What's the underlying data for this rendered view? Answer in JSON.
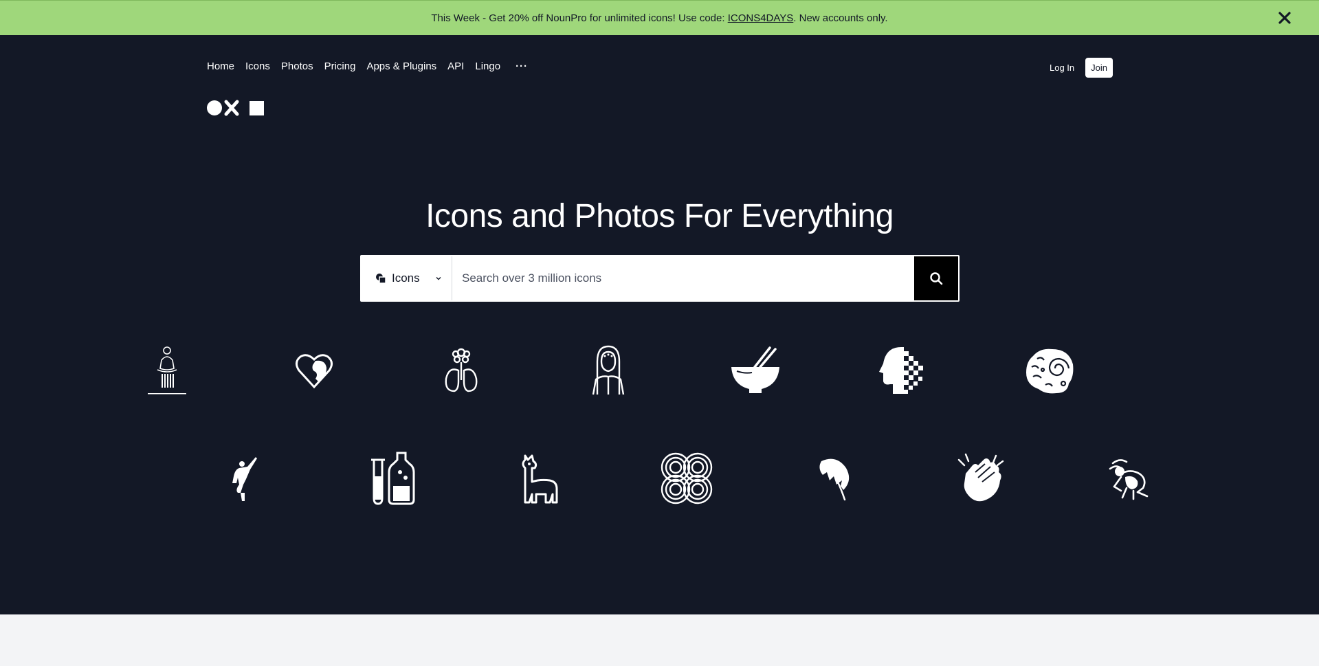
{
  "promo": {
    "text_before": "This Week - Get 20% off NounPro for unlimited icons! Use code: ",
    "code": "ICONS4DAYS",
    "text_after": ". New accounts only."
  },
  "nav": {
    "items": [
      {
        "label": "Home"
      },
      {
        "label": "Icons"
      },
      {
        "label": "Photos"
      },
      {
        "label": "Pricing"
      },
      {
        "label": "Apps & Plugins"
      },
      {
        "label": "API"
      },
      {
        "label": "Lingo"
      }
    ],
    "more": "···"
  },
  "auth": {
    "login": "Log In",
    "join": "Join"
  },
  "hero": {
    "headline": "Icons and Photos For Everything"
  },
  "search": {
    "type_label": "Icons",
    "placeholder": "Search over 3 million icons"
  },
  "colors": {
    "promo_bg": "#9fd77b",
    "hero_bg": "#131826",
    "page_bg": "#f3f4f6"
  },
  "featured_icons": [
    "meditating-figure-icon",
    "heart-face-icon",
    "lungs-flower-icon",
    "hooded-woman-icon",
    "bowl-chopsticks-icon",
    "pixel-head-icon",
    "brain-spiral-icon",
    "dancer-icon",
    "test-tube-bottle-icon",
    "llama-icon",
    "spiral-knot-icon",
    "monstera-leaf-icon",
    "clapping-hands-icon",
    "stylized-figure-icon"
  ]
}
